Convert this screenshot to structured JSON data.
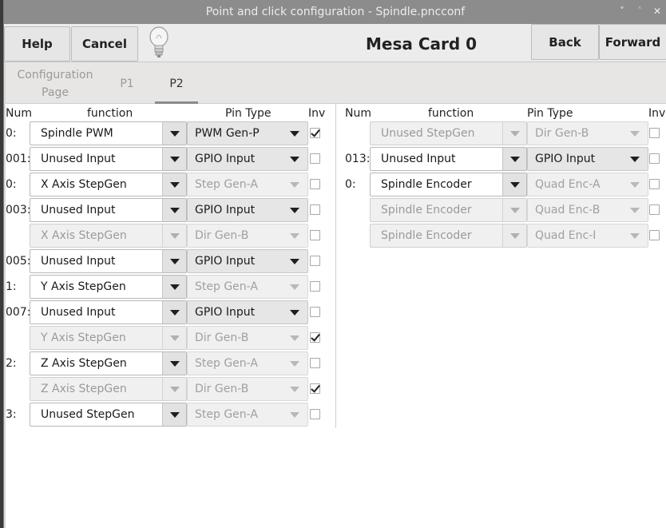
{
  "window": {
    "title": "Point and click configuration - Spindle.pncconf",
    "controls": [
      "˅",
      "˄",
      "✕"
    ]
  },
  "header": {
    "help_label": "Help",
    "cancel_label": "Cancel",
    "title": "Mesa Card 0",
    "back_label": "Back",
    "forward_label": "Forward",
    "hint_icon": "lightbulb-icon"
  },
  "tabs": [
    {
      "label": "Configuration\nPage",
      "active": false
    },
    {
      "label": "P1",
      "active": false
    },
    {
      "label": "P2",
      "active": true
    }
  ],
  "columns": {
    "num": "Num",
    "function": "function",
    "pin_type": "Pin Type",
    "inv": "Inv"
  },
  "left_rows": [
    {
      "num": "0:",
      "function": "Spindle PWM",
      "pin_type": "PWM Gen-P",
      "inv": true,
      "func_enabled": true,
      "pin_enabled": true
    },
    {
      "num": "001:",
      "function": "Unused Input",
      "pin_type": "GPIO Input",
      "inv": false,
      "func_enabled": true,
      "pin_enabled": true
    },
    {
      "num": "0:",
      "function": "X Axis StepGen",
      "pin_type": "Step Gen-A",
      "inv": false,
      "func_enabled": true,
      "pin_enabled": false
    },
    {
      "num": "003:",
      "function": "Unused Input",
      "pin_type": "GPIO Input",
      "inv": false,
      "func_enabled": true,
      "pin_enabled": true
    },
    {
      "num": "",
      "function": "X Axis StepGen",
      "pin_type": "Dir Gen-B",
      "inv": false,
      "func_enabled": false,
      "pin_enabled": false
    },
    {
      "num": "005:",
      "function": "Unused Input",
      "pin_type": "GPIO Input",
      "inv": false,
      "func_enabled": true,
      "pin_enabled": true
    },
    {
      "num": "1:",
      "function": "Y Axis StepGen",
      "pin_type": "Step Gen-A",
      "inv": false,
      "func_enabled": true,
      "pin_enabled": false
    },
    {
      "num": "007:",
      "function": "Unused Input",
      "pin_type": "GPIO Input",
      "inv": false,
      "func_enabled": true,
      "pin_enabled": true
    },
    {
      "num": "",
      "function": "Y Axis StepGen",
      "pin_type": "Dir Gen-B",
      "inv": true,
      "func_enabled": false,
      "pin_enabled": false
    },
    {
      "num": "2:",
      "function": "Z Axis StepGen",
      "pin_type": "Step Gen-A",
      "inv": false,
      "func_enabled": true,
      "pin_enabled": false
    },
    {
      "num": "",
      "function": "Z Axis StepGen",
      "pin_type": "Dir Gen-B",
      "inv": true,
      "func_enabled": false,
      "pin_enabled": false
    },
    {
      "num": "3:",
      "function": "Unused StepGen",
      "pin_type": "Step Gen-A",
      "inv": false,
      "func_enabled": true,
      "pin_enabled": false
    }
  ],
  "right_rows": [
    {
      "num": "",
      "function": "Unused StepGen",
      "pin_type": "Dir Gen-B",
      "inv": false,
      "func_enabled": false,
      "pin_enabled": false
    },
    {
      "num": "013:",
      "function": "Unused Input",
      "pin_type": "GPIO Input",
      "inv": false,
      "func_enabled": true,
      "pin_enabled": true
    },
    {
      "num": "0:",
      "function": "Spindle Encoder",
      "pin_type": "Quad Enc-A",
      "inv": false,
      "func_enabled": true,
      "pin_enabled": false
    },
    {
      "num": "",
      "function": "Spindle Encoder",
      "pin_type": "Quad Enc-B",
      "inv": false,
      "func_enabled": false,
      "pin_enabled": false
    },
    {
      "num": "",
      "function": "Spindle Encoder",
      "pin_type": "Quad Enc-I",
      "inv": false,
      "func_enabled": false,
      "pin_enabled": false
    }
  ]
}
